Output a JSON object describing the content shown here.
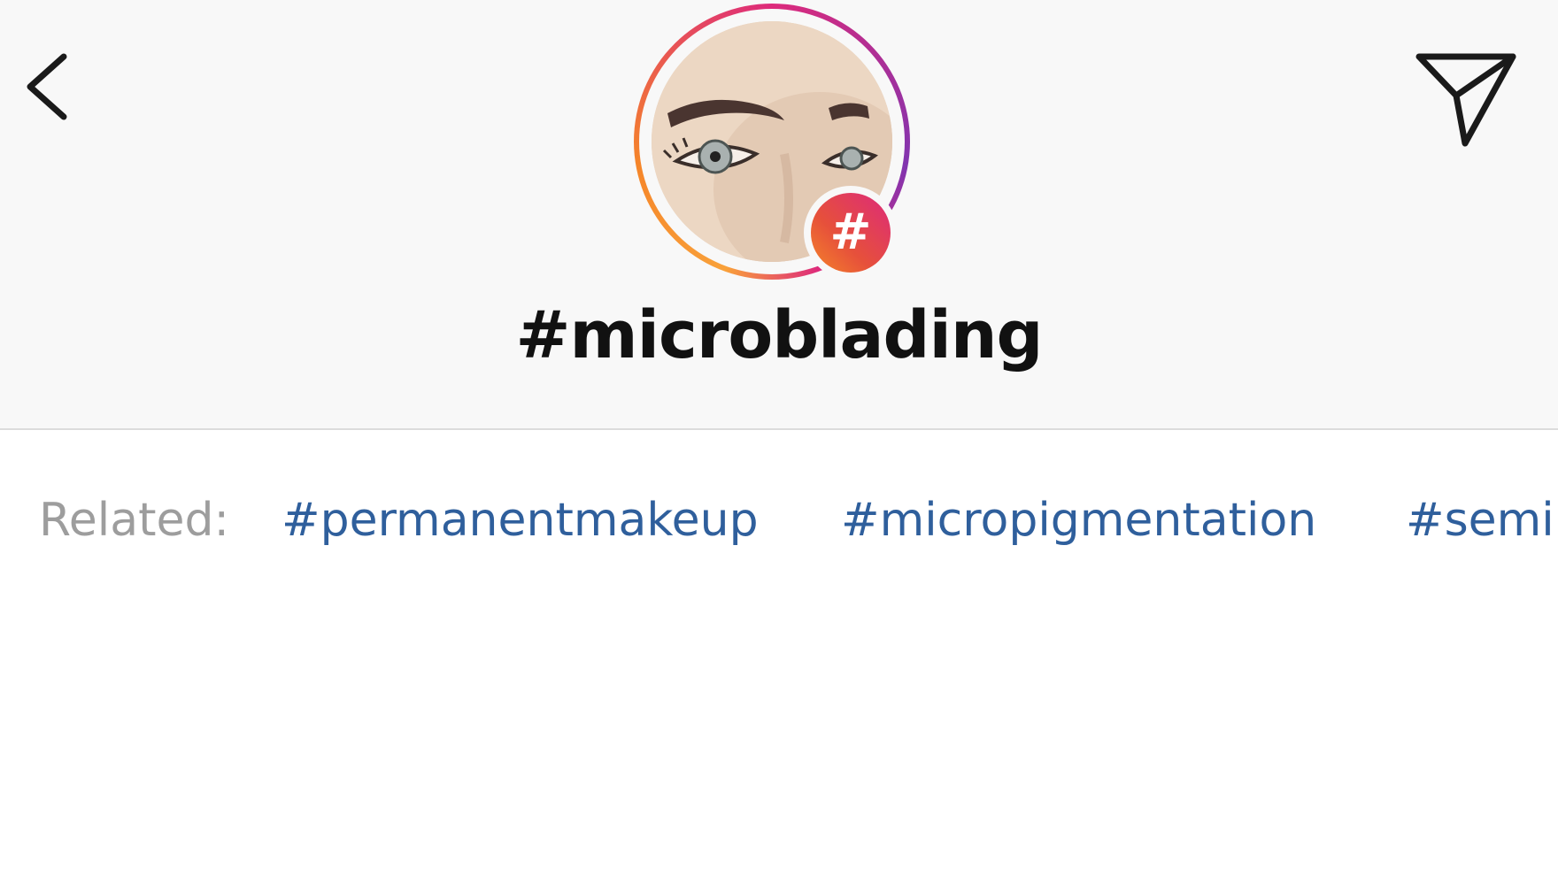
{
  "header": {
    "back_icon": "chevron-left-icon",
    "share_icon": "paper-plane-icon",
    "badge_symbol": "#",
    "hashtag_title": "#microblading",
    "ring_colors": [
      "#f58529",
      "#dd2a7b",
      "#8134af"
    ]
  },
  "related": {
    "label": "Related:",
    "tags": [
      "#permanentmakeup",
      "#micropigmentation",
      "#semi"
    ]
  },
  "colors": {
    "link": "#2f5f9c",
    "label": "#9d9d9d",
    "header_bg": "#f8f8f8"
  }
}
